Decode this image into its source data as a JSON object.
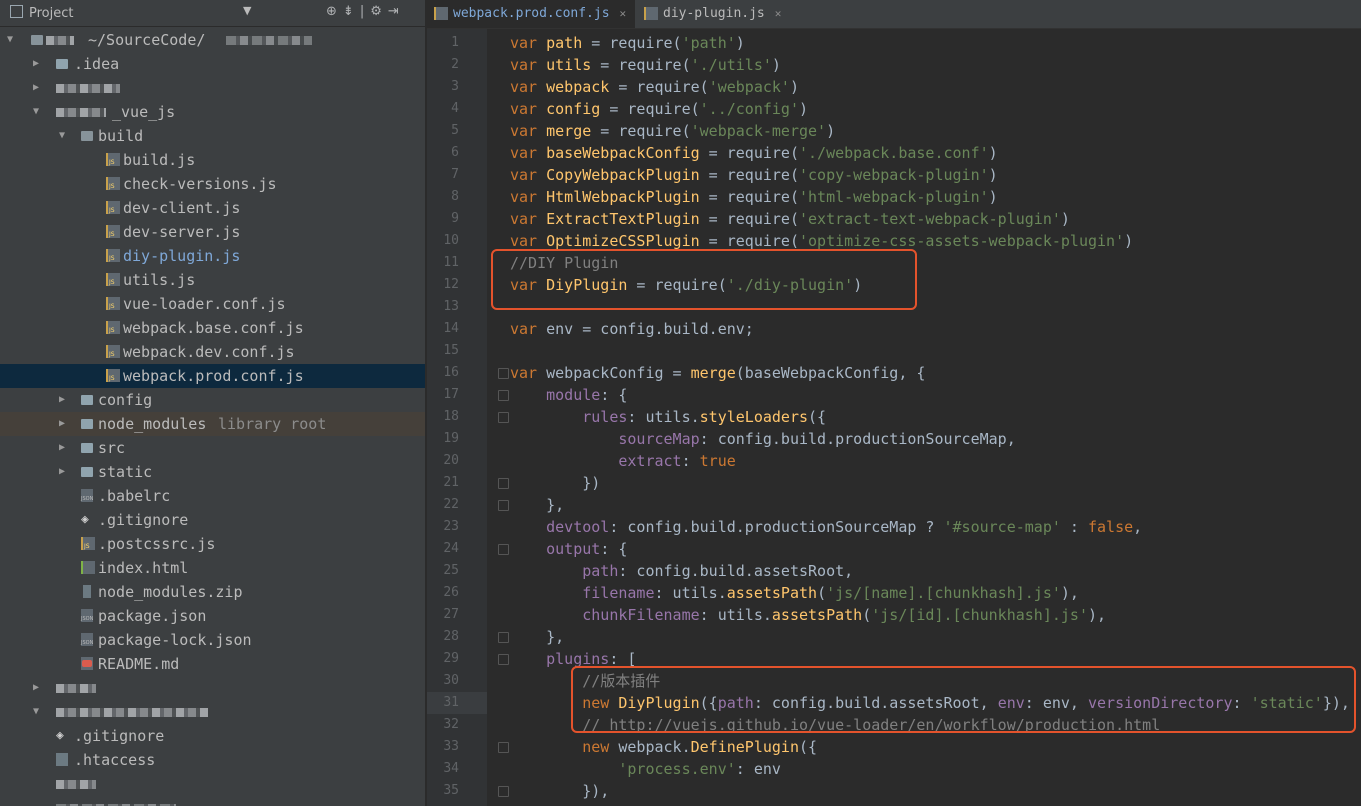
{
  "sidebar": {
    "title": "Project",
    "rows": [
      {
        "type": "root",
        "label": "~/SourceCode/"
      },
      {
        "type": "folder",
        "label": ".idea"
      },
      {
        "type": "blurred"
      },
      {
        "type": "folder",
        "label": "_vue_js"
      },
      {
        "type": "folder-open",
        "label": "build"
      },
      {
        "type": "js",
        "label": "build.js"
      },
      {
        "type": "js",
        "label": "check-versions.js"
      },
      {
        "type": "js",
        "label": "dev-client.js"
      },
      {
        "type": "js",
        "label": "dev-server.js"
      },
      {
        "type": "js",
        "label": "diy-plugin.js"
      },
      {
        "type": "js",
        "label": "utils.js"
      },
      {
        "type": "js",
        "label": "vue-loader.conf.js"
      },
      {
        "type": "js",
        "label": "webpack.base.conf.js"
      },
      {
        "type": "js",
        "label": "webpack.dev.conf.js"
      },
      {
        "type": "js",
        "label": "webpack.prod.conf.js"
      },
      {
        "type": "folder",
        "label": "config"
      },
      {
        "type": "folder",
        "label": "node_modules",
        "suffix": "library root"
      },
      {
        "type": "folder",
        "label": "src"
      },
      {
        "type": "folder",
        "label": "static"
      },
      {
        "type": "json",
        "label": ".babelrc"
      },
      {
        "type": "git",
        "label": ".gitignore"
      },
      {
        "type": "js",
        "label": ".postcssrc.js"
      },
      {
        "type": "html",
        "label": "index.html"
      },
      {
        "type": "zip",
        "label": "node_modules.zip"
      },
      {
        "type": "json",
        "label": "package.json"
      },
      {
        "type": "json",
        "label": "package-lock.json"
      },
      {
        "type": "md",
        "label": "README.md"
      },
      {
        "type": "git",
        "label": ".gitignore"
      },
      {
        "type": "file",
        "label": ".htaccess"
      }
    ]
  },
  "editor": {
    "tabs": [
      {
        "label": "webpack.prod.conf.js"
      },
      {
        "label": "diy-plugin.js"
      }
    ],
    "line_numbers": [
      "1",
      "2",
      "3",
      "4",
      "5",
      "6",
      "7",
      "8",
      "9",
      "10",
      "11",
      "12",
      "13",
      "14",
      "15",
      "16",
      "17",
      "18",
      "19",
      "20",
      "21",
      "22",
      "23",
      "24",
      "25",
      "26",
      "27",
      "28",
      "29",
      "30",
      "31",
      "32",
      "33",
      "34",
      "35"
    ],
    "code": {
      "l1": {
        "kw": "var",
        "name": "path",
        "fn": "require",
        "str": "'path'"
      },
      "l2": {
        "kw": "var",
        "name": "utils",
        "fn": "require",
        "str": "'./utils'"
      },
      "l3": {
        "kw": "var",
        "name": "webpack",
        "fn": "require",
        "str": "'webpack'"
      },
      "l4": {
        "kw": "var",
        "name": "config",
        "fn": "require",
        "str": "'../config'"
      },
      "l5": {
        "kw": "var",
        "name": "merge",
        "fn": "require",
        "str": "'webpack-merge'"
      },
      "l6": {
        "kw": "var",
        "name": "baseWebpackConfig",
        "fn": "require",
        "str": "'./webpack.base.conf'"
      },
      "l7": {
        "kw": "var",
        "name": "CopyWebpackPlugin",
        "fn": "require",
        "str": "'copy-webpack-plugin'"
      },
      "l8": {
        "kw": "var",
        "name": "HtmlWebpackPlugin",
        "fn": "require",
        "str": "'html-webpack-plugin'"
      },
      "l9": {
        "kw": "var",
        "name": "ExtractTextPlugin",
        "fn": "require",
        "str": "'extract-text-webpack-plugin'"
      },
      "l10": {
        "kw": "var",
        "name": "OptimizeCSSPlugin",
        "fn": "require",
        "str": "'optimize-css-assets-webpack-plugin'"
      },
      "l11": {
        "comment": "//DIY Plugin"
      },
      "l12": {
        "kw": "var",
        "name": "DiyPlugin",
        "fn": "require",
        "str": "'./diy-plugin'"
      },
      "l14": {
        "kw": "var",
        "rest": "env = config.build.env;"
      },
      "l16": {
        "kw": "var",
        "name": "webpackConfig",
        "fn": "merge",
        "rest": "(baseWebpackConfig, {"
      },
      "l17": {
        "prop": "module",
        "rest": ": {"
      },
      "l18": {
        "prop": "rules",
        "rest": ": utils.",
        "fn": "styleLoaders",
        "rest2": "({"
      },
      "l19": {
        "prop": "sourceMap",
        "rest": ": config.build.productionSourceMap,"
      },
      "l20": {
        "prop": "extract",
        "rest": ": ",
        "kw": "true"
      },
      "l21": {
        "rest": "})"
      },
      "l22": {
        "rest": "},"
      },
      "l23": {
        "prop": "devtool",
        "rest": ": config.build.productionSourceMap ? ",
        "str": "'#source-map'",
        "rest2": " : ",
        "kw": "false",
        "rest3": ","
      },
      "l24": {
        "prop": "output",
        "rest": ": {"
      },
      "l25": {
        "prop": "path",
        "rest": ": config.build.assetsRoot,"
      },
      "l26": {
        "prop": "filename",
        "rest": ": utils.",
        "fn": "assetsPath",
        "str": "'js/[name].[chunkhash].js'",
        "rest2": "),"
      },
      "l27": {
        "prop": "chunkFilename",
        "rest": ": utils.",
        "fn": "assetsPath",
        "str": "'js/[id].[chunkhash].js'",
        "rest2": "),"
      },
      "l28": {
        "rest": "},"
      },
      "l29": {
        "prop": "plugins",
        "rest": ": ["
      },
      "l30": {
        "comment": "//版本插件"
      },
      "l31": {
        "kw": "new",
        "fn": "DiyPlugin",
        "path": "path",
        "r1": ": config.build.assetsRoot, ",
        "env": "env",
        "r2": ": env, ",
        "vd": "versionDirectory",
        "r3": ": ",
        "str": "'static'",
        "r4": "}),"
      },
      "l32": {
        "comment": "// http://vuejs.github.io/vue-loader/en/workflow/production.html"
      },
      "l33": {
        "kw": "new",
        "r1": " webpack.",
        "fn": "DefinePlugin",
        "r2": "({"
      },
      "l34": {
        "str": "'process.env'",
        "rest": ": env"
      },
      "l35": {
        "rest": "}),"
      }
    }
  },
  "colors": {
    "highlight_box": "#e4532c",
    "keyword": "#cc7832",
    "function": "#ffc66d",
    "string": "#6a8759",
    "property": "#9876aa",
    "comment": "#808080"
  }
}
